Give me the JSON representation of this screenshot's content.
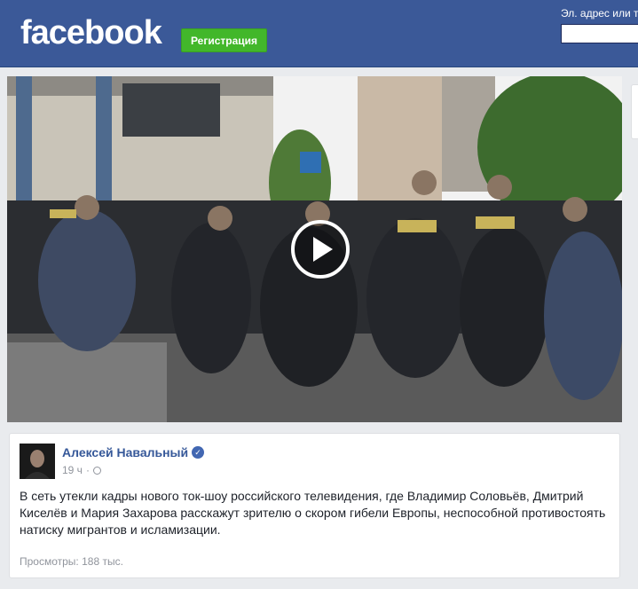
{
  "header": {
    "logo": "facebook",
    "register_label": "Регистрация",
    "login_label": "Эл. адрес или т",
    "login_value": ""
  },
  "video": {
    "scene": "police-crowd-photo",
    "play_icon": "play-icon"
  },
  "post": {
    "author": "Алексей Навальный",
    "verified_icon": "verified-badge-icon",
    "time": "19 ч",
    "separator": "·",
    "privacy_icon": "globe-icon",
    "text": "В сеть утекли кадры нового ток-шоу российского телевидения, где Владимир Соловьёв, Дмитрий Киселёв и Мария Захарова расскажут зрителю о скором гибели Европы, неспособной противостоять натиску мигрантов и исламизации.",
    "views": "Просмотры: 188 тыс."
  },
  "colors": {
    "brand": "#3b5998",
    "register_green": "#42b72a",
    "link": "#365899"
  }
}
